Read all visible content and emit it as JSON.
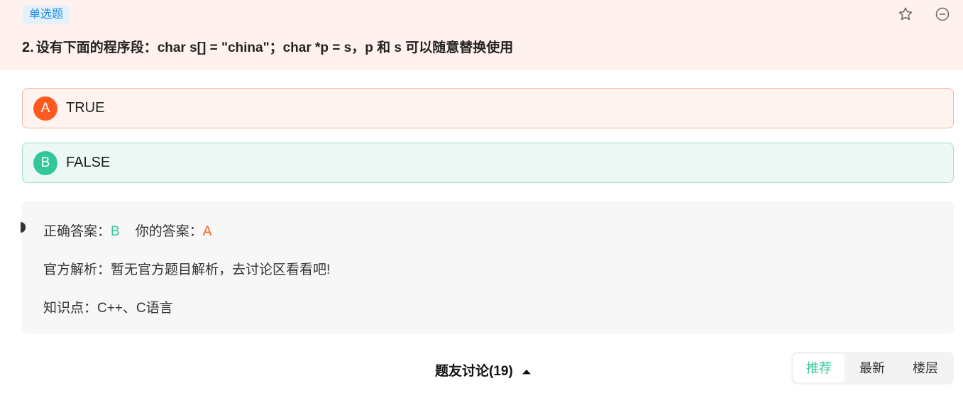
{
  "question": {
    "type_label": "单选题",
    "number": "2.",
    "text": "设有下面的程序段：char s[] = \"china\"；char *p = s，p 和 s 可以随意替换使用",
    "icons": {
      "favorite": "star-outline-icon",
      "hide": "minus-circle-icon"
    }
  },
  "options": [
    {
      "letter": "A",
      "text": "TRUE"
    },
    {
      "letter": "B",
      "text": "FALSE"
    }
  ],
  "answer": {
    "correct_label": "正确答案：",
    "correct_value": "B",
    "yours_label": "你的答案：",
    "yours_value": "A",
    "analysis": "官方解析：暂无官方题目解析，去讨论区看看吧!",
    "knowledge": "知识点：C++、C语言"
  },
  "discussion": {
    "label": "题友讨论(19)",
    "toggle_icon": "caret-up-icon"
  },
  "sort_tabs": [
    "推荐",
    "最新",
    "楼层"
  ],
  "colors": {
    "header_bg": "#fff1ed",
    "accent_orange": "#fc5a20",
    "accent_green": "#32c79a",
    "tag_blue": "#1e88e5"
  }
}
